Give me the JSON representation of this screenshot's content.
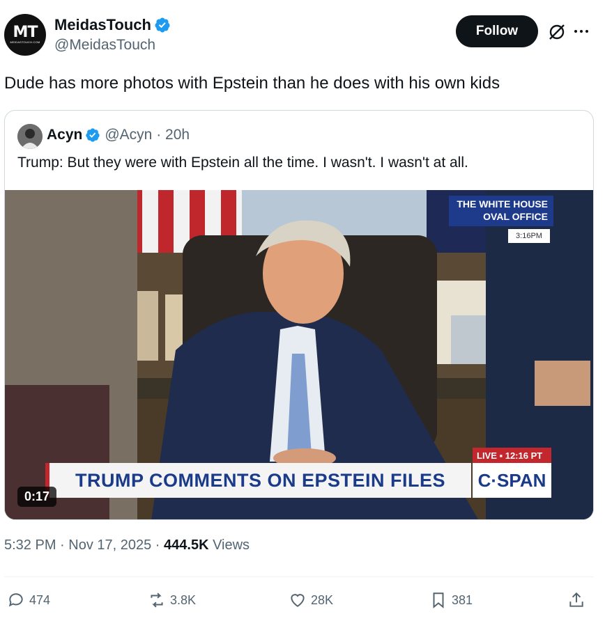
{
  "author": {
    "display_name": "MeidasTouch",
    "handle": "@MeidasTouch",
    "avatar_text": "MT",
    "avatar_subtext": "MEIDASTOUCH.COM"
  },
  "actions_top": {
    "follow_label": "Follow"
  },
  "tweet": {
    "text": "Dude has more photos with Epstein than he does with his own kids"
  },
  "quote": {
    "display_name": "Acyn",
    "handle_time": "@Acyn · 20h",
    "text": "Trump: But they were with Epstein all the time. I wasn't. I wasn't at all.",
    "video": {
      "duration": "0:17",
      "badge_line1": "THE WHITE HOUSE",
      "badge_line2": "OVAL OFFICE",
      "badge_time": "3:16PM",
      "lower_third": "TRUMP COMMENTS ON EPSTEIN FILES",
      "live_label": "LIVE ▪ 12:16 PT",
      "network": "C·SPAN"
    }
  },
  "meta": {
    "time": "5:32 PM · Nov 17, 2025 · ",
    "views_count": "444.5K",
    "views_label": " Views"
  },
  "stats": {
    "replies": "474",
    "reposts": "3.8K",
    "likes": "28K",
    "bookmarks": "381"
  },
  "colors": {
    "accent": "#1d9bf0",
    "text": "#0f1419",
    "secondary": "#536471",
    "border": "#cfd9de"
  }
}
